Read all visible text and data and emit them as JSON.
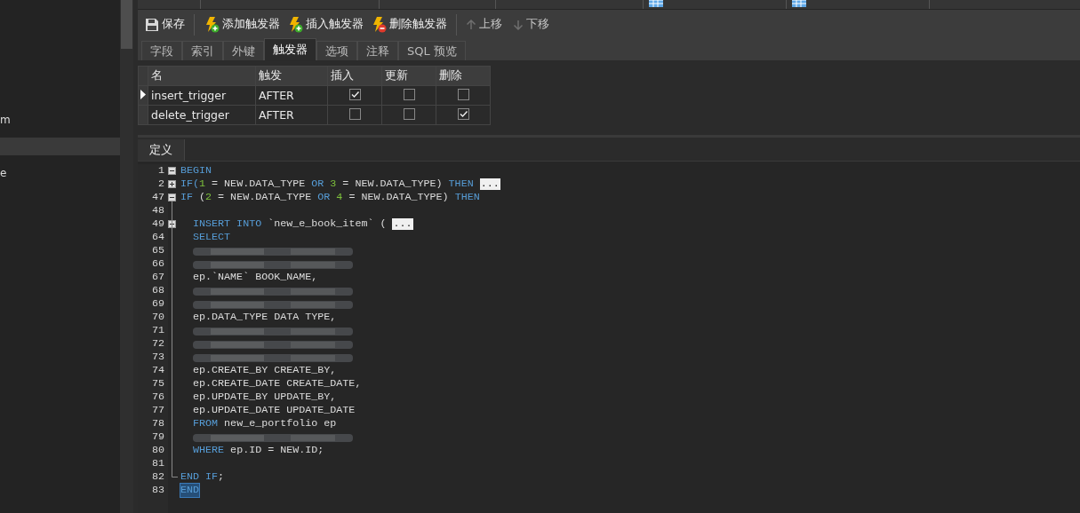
{
  "sidebar": {
    "items": [
      {
        "label": "m",
        "selected": false
      },
      {
        "selected": true
      },
      {
        "label": "e",
        "selected": false
      }
    ]
  },
  "toolbar": {
    "buttons": [
      {
        "label": "保存",
        "kind": "save",
        "disabled": false
      },
      {
        "label": "添加触发器",
        "kind": "add",
        "disabled": false
      },
      {
        "label": "插入触发器",
        "kind": "add",
        "disabled": false
      },
      {
        "label": "删除触发器",
        "kind": "delete",
        "disabled": false
      },
      {
        "label": "上移",
        "kind": "up",
        "disabled": true
      },
      {
        "label": "下移",
        "kind": "down",
        "disabled": true
      }
    ]
  },
  "tabs": [
    {
      "label": "字段",
      "selected": false
    },
    {
      "label": "索引",
      "selected": false
    },
    {
      "label": "外键",
      "selected": false
    },
    {
      "label": "触发器",
      "selected": true
    },
    {
      "label": "选项",
      "selected": false
    },
    {
      "label": "注释",
      "selected": false
    },
    {
      "label": "SQL 预览",
      "selected": false
    }
  ],
  "trigger_table": {
    "columns": [
      "名",
      "触发",
      "插入",
      "更新",
      "删除"
    ],
    "rows": [
      {
        "name": "insert_trigger",
        "timing": "AFTER",
        "insert": true,
        "update": false,
        "delete": false,
        "selected": true
      },
      {
        "name": "delete_trigger",
        "timing": "AFTER",
        "insert": false,
        "update": false,
        "delete": true,
        "selected": false
      }
    ]
  },
  "definition_tab": {
    "label": "定义",
    "selected": true
  },
  "editor": {
    "lines": [
      {
        "number": "1",
        "expanded": true,
        "tokens": [
          {
            "text": "BEGIN",
            "kind": "keyword"
          }
        ]
      },
      {
        "number": "2",
        "expanded": false,
        "collapsed": "...",
        "tokens": [
          {
            "text": "IF(",
            "kind": "keyword"
          },
          {
            "text": "1",
            "kind": "number"
          },
          {
            "text": " = NEW.DATA_TYPE ",
            "kind": "plain"
          },
          {
            "text": "OR ",
            "kind": "keyword"
          },
          {
            "text": "3",
            "kind": "number"
          },
          {
            "text": " = NEW.DATA_TYPE) ",
            "kind": "plain"
          },
          {
            "text": "THEN",
            "kind": "keyword"
          }
        ]
      },
      {
        "number": "47",
        "expanded": true,
        "tokens": [
          {
            "text": "IF",
            "kind": "keyword"
          },
          {
            "text": " (",
            "kind": "plain"
          },
          {
            "text": "2",
            "kind": "number"
          },
          {
            "text": " = NEW.DATA_TYPE ",
            "kind": "plain"
          },
          {
            "text": "OR ",
            "kind": "keyword"
          },
          {
            "text": "4",
            "kind": "number"
          },
          {
            "text": " = NEW.DATA_TYPE) ",
            "kind": "plain"
          },
          {
            "text": "THEN",
            "kind": "keyword"
          }
        ]
      },
      {
        "number": "48"
      },
      {
        "number": "49",
        "expanded": false,
        "collapsed": "...",
        "tokens": [
          {
            "text": "  INSERT INTO",
            "kind": "keyword"
          },
          {
            "text": " `new_e_book_item` (",
            "kind": "plain"
          }
        ]
      },
      {
        "number": "64",
        "tokens": [
          {
            "text": "  SELECT",
            "kind": "keyword"
          }
        ]
      },
      {
        "number": "65",
        "redacted": true
      },
      {
        "number": "66",
        "redacted": true
      },
      {
        "number": "67",
        "tokens": [
          {
            "text": "  ep.`NAME` BOOK_NAME,",
            "kind": "plain"
          }
        ]
      },
      {
        "number": "68",
        "redacted": true
      },
      {
        "number": "69",
        "redacted": true
      },
      {
        "number": "70",
        "tokens": [
          {
            "text": "  ep.DATA_TYPE DATA TYPE,",
            "kind": "plain"
          }
        ]
      },
      {
        "number": "71",
        "redacted": true
      },
      {
        "number": "72",
        "redacted": true
      },
      {
        "number": "73",
        "redacted": true
      },
      {
        "number": "74",
        "tokens": [
          {
            "text": "  ep.CREATE_BY CREATE_BY,",
            "kind": "plain"
          }
        ]
      },
      {
        "number": "75",
        "tokens": [
          {
            "text": "  ep.CREATE_DATE CREATE_DATE,",
            "kind": "plain"
          }
        ]
      },
      {
        "number": "76",
        "tokens": [
          {
            "text": "  ep.UPDATE_BY UPDATE_BY,",
            "kind": "plain"
          }
        ]
      },
      {
        "number": "77",
        "tokens": [
          {
            "text": "  ep.UPDATE_DATE UPDATE_DATE",
            "kind": "plain"
          }
        ]
      },
      {
        "number": "78",
        "tokens": [
          {
            "text": "  FROM",
            "kind": "keyword"
          },
          {
            "text": " new_e_portfolio ep",
            "kind": "plain"
          }
        ]
      },
      {
        "number": "79",
        "redacted": true
      },
      {
        "number": "80",
        "tokens": [
          {
            "text": "  WHERE",
            "kind": "keyword"
          },
          {
            "text": " ep.ID = NEW.ID;",
            "kind": "plain"
          }
        ]
      },
      {
        "number": "81"
      },
      {
        "number": "82",
        "fold_end": true,
        "tokens": [
          {
            "text": "END IF",
            "kind": "keyword"
          },
          {
            "text": ";",
            "kind": "plain"
          }
        ]
      },
      {
        "number": "83",
        "selected": true,
        "tokens": [
          {
            "text": "END",
            "kind": "keyword"
          }
        ]
      }
    ]
  }
}
